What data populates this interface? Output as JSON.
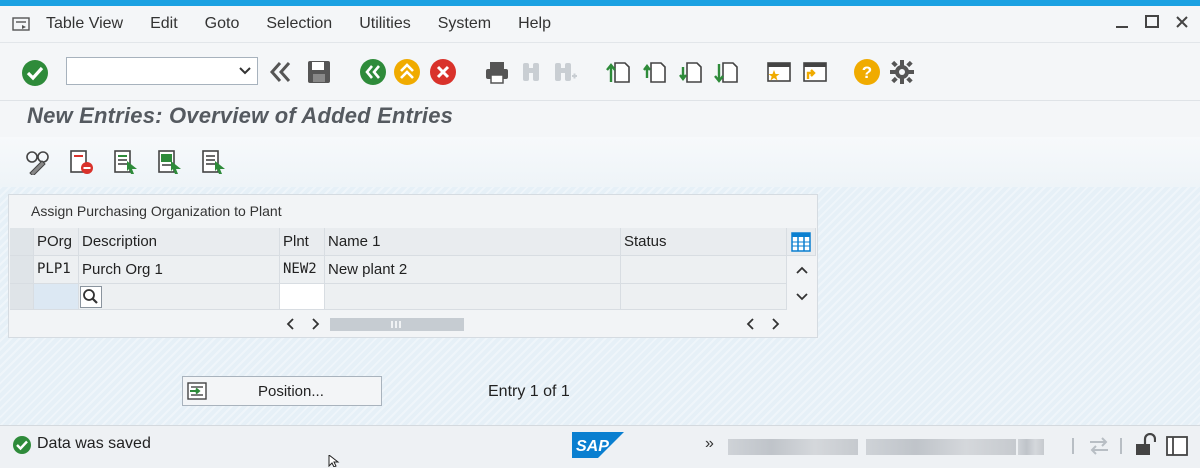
{
  "menu": {
    "items": [
      {
        "label": "Table View"
      },
      {
        "label": "Edit"
      },
      {
        "label": "Goto"
      },
      {
        "label": "Selection"
      },
      {
        "label": "Utilities"
      },
      {
        "label": "System"
      },
      {
        "label": "Help"
      }
    ]
  },
  "toolbar": {
    "command_field_value": "",
    "icons": [
      "enter-icon",
      "back-icon",
      "save-icon",
      "back-green-icon",
      "exit-icon",
      "cancel-icon",
      "print-icon",
      "find-icon",
      "find-next-icon",
      "first-page-icon",
      "previous-page-icon",
      "next-page-icon",
      "last-page-icon",
      "create-session-icon",
      "shortcut-icon",
      "help-icon",
      "customize-icon"
    ]
  },
  "page": {
    "title": "New Entries: Overview of Added Entries"
  },
  "table": {
    "caption": "Assign Purchasing Organization to Plant",
    "columns": [
      "POrg",
      "Description",
      "Plnt",
      "Name 1",
      "Status"
    ],
    "rows": [
      {
        "porg": "PLP1",
        "description": "Purch Org 1",
        "plnt": "NEW2",
        "name1": "New plant 2",
        "status": ""
      },
      {
        "porg": "",
        "description": "",
        "plnt": "",
        "name1": "",
        "status": ""
      }
    ]
  },
  "position_button": {
    "label": "Position..."
  },
  "entry_info": "Entry 1 of 1",
  "status": {
    "message": "Data was saved",
    "more_marker": "»"
  },
  "colors": {
    "accent_blue": "#1ba1e2",
    "ok_green": "#2e8b3a",
    "cancel_red": "#d9322b",
    "sap_blue": "#0a7fd0",
    "help_orange": "#f0ab00"
  }
}
